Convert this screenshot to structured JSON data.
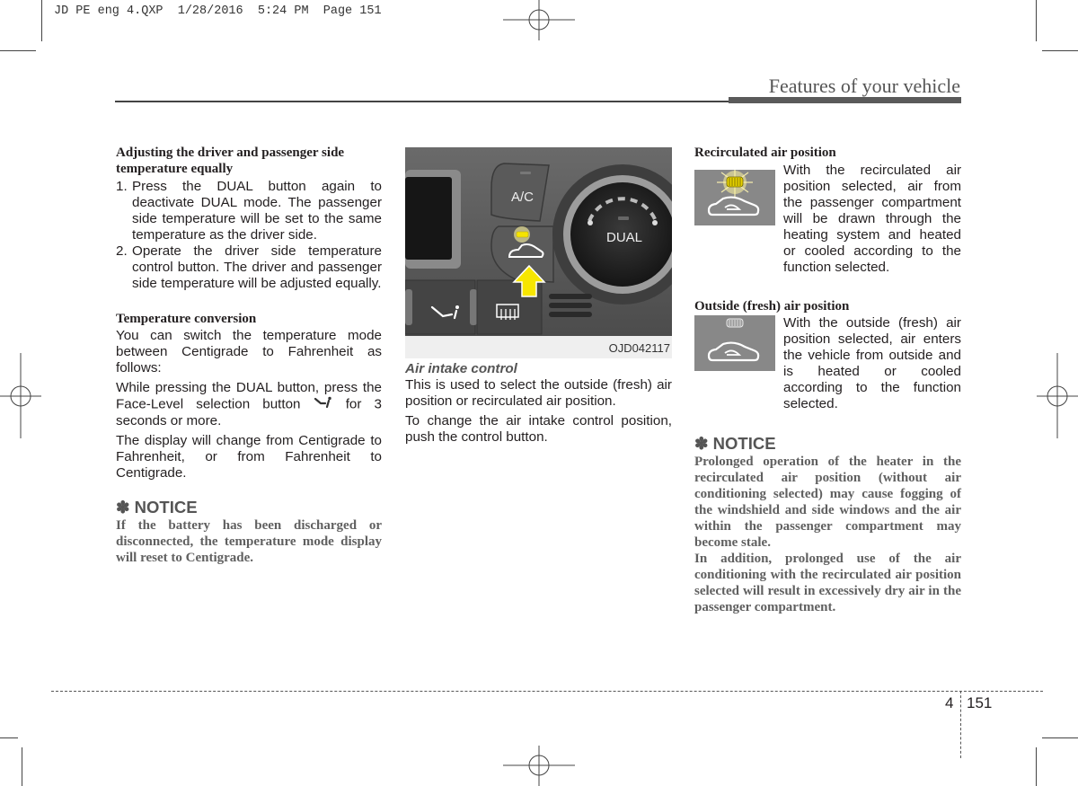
{
  "slug": {
    "text": "JD PE eng 4.QXP  1/28/2016  5:24 PM  Page 151"
  },
  "header": {
    "title": "Features of your vehicle"
  },
  "column1": {
    "section1": {
      "heading": "Adjusting the driver and passenger side temperature equally",
      "steps": [
        {
          "num": "1.",
          "text": "Press the DUAL button again to deactivate DUAL mode. The passenger side temperature will be set to the same temperature as the driver side."
        },
        {
          "num": "2.",
          "text": "Operate the driver side temperature control button. The driver and passenger side temperature will be adjusted equally."
        }
      ]
    },
    "section2": {
      "heading": "Temperature conversion",
      "para1": "You can switch the temperature mode between Centigrade to Fahrenheit as follows:",
      "para2_before": "While pressing the DUAL button, press the Face-Level selection button",
      "para2_icon": "face-level-icon",
      "para2_after": " for 3 seconds or more.",
      "para3": "The display will change from Centigrade to Fahrenheit, or from Fahrenheit to Centigrade."
    },
    "notice": {
      "symbol": "✽",
      "heading": "NOTICE",
      "body": "If the battery has been discharged or disconnected, the temperature mode display will reset to Centigrade."
    }
  },
  "figure": {
    "code": "OJD042117",
    "labels": {
      "ac": "A/C",
      "dual": "DUAL"
    },
    "highlight_color": "#f5e400",
    "arrow_color": "#f7e600"
  },
  "column2": {
    "heading": "Air intake control",
    "para1": "This is used to select the outside (fresh) air position or recirculated air position.",
    "para2": "To change the air intake control position, push the control button."
  },
  "column3": {
    "recirc": {
      "heading": "Recirculated air position",
      "icon": "recirculated-air-icon",
      "text": "With the recirculated air position selected, air from the passenger compartment will be drawn through the heating system and heated or cooled according to the function selected."
    },
    "outside": {
      "heading": "Outside (fresh) air position",
      "icon": "outside-air-icon",
      "text": "With the outside (fresh) air position selected, air enters the vehicle from outside and is heated or cooled according to the function selected."
    },
    "notice": {
      "symbol": "✽",
      "heading": "NOTICE",
      "body1": "Prolonged operation of the heater in the recirculated air position (without air conditioning selected) may cause fogging of the windshield and side windows and the air within the passenger compartment may become stale.",
      "body2": "In addition, prolonged use of the air conditioning with the recirculated air position selected will result in excessively dry air in the passenger compartment."
    }
  },
  "footer": {
    "chapter": "4",
    "page": "151"
  }
}
